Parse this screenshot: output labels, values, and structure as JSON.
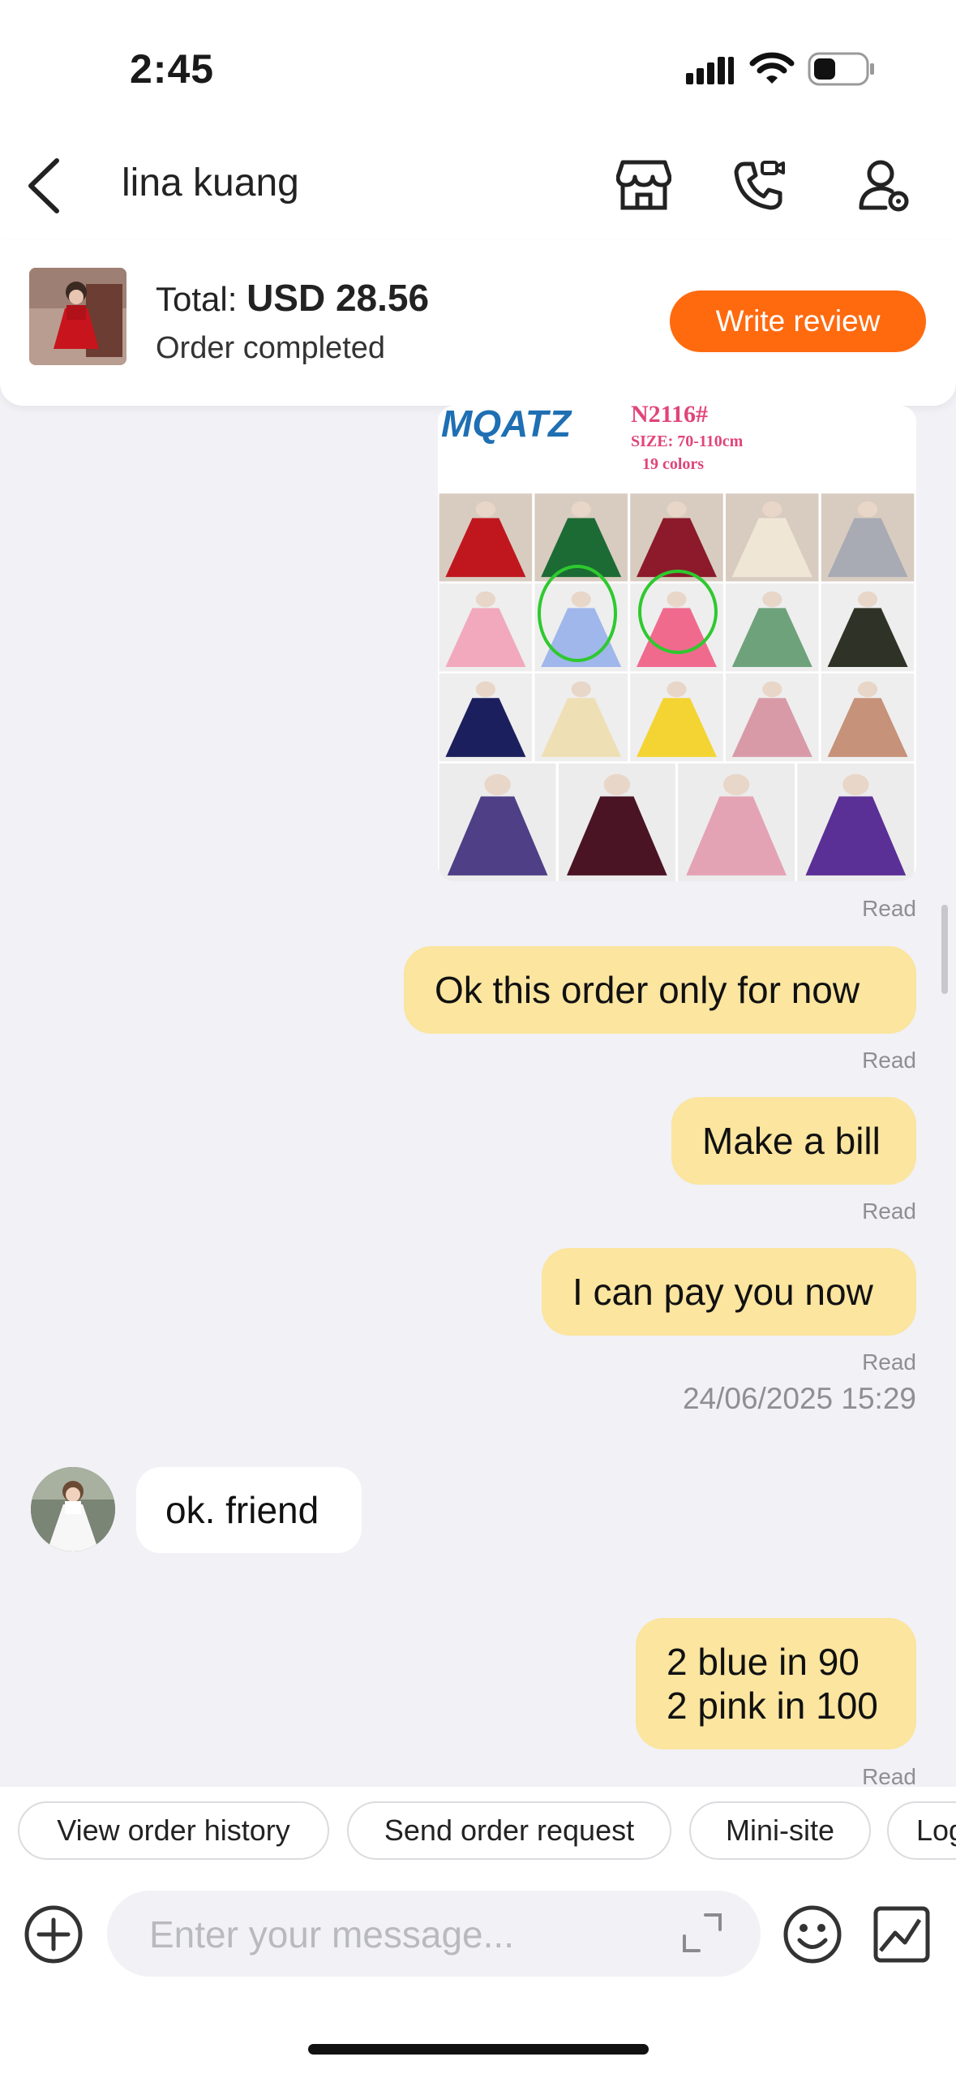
{
  "status_bar": {
    "time": "2:45"
  },
  "header": {
    "title": "lina kuang",
    "icons": [
      "back-arrow-icon",
      "store-icon",
      "video-call-icon",
      "user-settings-icon"
    ]
  },
  "order": {
    "total_label": "Total:",
    "total_value": "USD 28.56",
    "status": "Order completed",
    "review_button": "Write review"
  },
  "chat": {
    "image_message": {
      "brand": "MQATZ",
      "model": "N2116#",
      "size": "SIZE: 70-110cm",
      "colors": "19 colors",
      "read": "Read"
    },
    "messages": [
      {
        "text": "Ok this order only for now",
        "read": "Read"
      },
      {
        "text": "Make a bill",
        "read": "Read"
      },
      {
        "text": "I can pay you now",
        "read": "Read"
      }
    ],
    "timestamp": "24/06/2025 15:29",
    "incoming": {
      "text": "ok. friend"
    },
    "last_message": {
      "line1": "2 blue in 90",
      "line2": "2 pink in 100",
      "read": "Read"
    }
  },
  "quick_actions": [
    "View order history",
    "Send order request",
    "Mini-site",
    "Log"
  ],
  "composer": {
    "placeholder": "Enter your message..."
  },
  "colors": {
    "accent": "#ff6a0f",
    "bubble_out": "#fbe59f",
    "background": "#f1f1f6"
  }
}
